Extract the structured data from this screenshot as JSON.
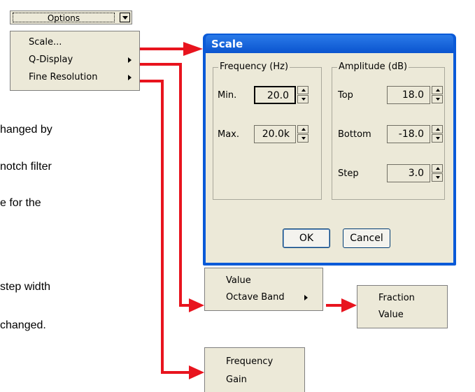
{
  "options_combo": {
    "label": "Options"
  },
  "options_menu": {
    "items": [
      {
        "label": "Scale..."
      },
      {
        "label": "Q-Display"
      },
      {
        "label": "Fine Resolution"
      }
    ]
  },
  "body_text": [
    "hanged by",
    "notch filter",
    "e for the",
    "step width",
    "changed."
  ],
  "scale_dialog": {
    "title": "Scale",
    "frequency_group": {
      "title": "Frequency (Hz)",
      "min_label": "Min.",
      "min_value": "20.0",
      "max_label": "Max.",
      "max_value": "20.0k"
    },
    "amplitude_group": {
      "title": "Amplitude (dB)",
      "top_label": "Top",
      "top_value": "18.0",
      "bottom_label": "Bottom",
      "bottom_value": "-18.0",
      "step_label": "Step",
      "step_value": "3.0"
    },
    "ok_label": "OK",
    "cancel_label": "Cancel"
  },
  "q_display_menu": {
    "items": [
      {
        "label": "Value"
      },
      {
        "label": "Octave Band"
      }
    ]
  },
  "octave_band_menu": {
    "items": [
      {
        "label": "Fraction"
      },
      {
        "label": "Value"
      }
    ]
  },
  "fine_resolution_menu": {
    "items": [
      {
        "label": "Frequency"
      },
      {
        "label": "Gain"
      }
    ]
  },
  "colors": {
    "arrow": "#e8141e",
    "titlebar": "#0a5ad8",
    "dialog_face": "#ece9d8"
  }
}
